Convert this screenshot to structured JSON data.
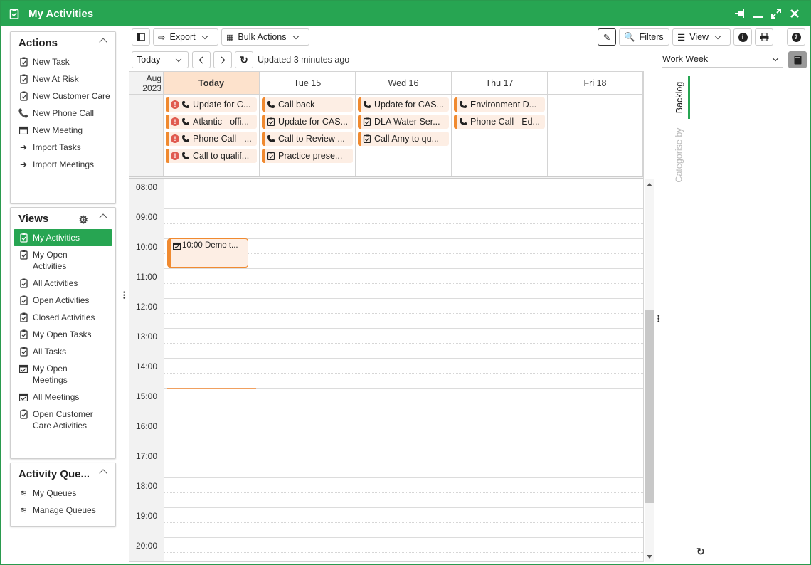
{
  "window": {
    "title": "My Activities"
  },
  "actions": {
    "title": "Actions",
    "items": [
      {
        "label": "New Task",
        "icon": "task-icon"
      },
      {
        "label": "New At Risk",
        "icon": "task-icon"
      },
      {
        "label": "New Customer Care",
        "icon": "task-icon"
      },
      {
        "label": "New Phone Call",
        "icon": "phone-icon"
      },
      {
        "label": "New Meeting",
        "icon": "calendar-icon"
      },
      {
        "label": "Import Tasks",
        "icon": "import-icon"
      },
      {
        "label": "Import Meetings",
        "icon": "import-icon"
      }
    ]
  },
  "views": {
    "title": "Views",
    "items": [
      {
        "label": "My Activities",
        "icon": "task-icon"
      },
      {
        "label": "My Open Activities",
        "icon": "task-icon"
      },
      {
        "label": "All Activities",
        "icon": "task-icon"
      },
      {
        "label": "Open Activities",
        "icon": "task-icon"
      },
      {
        "label": "Closed Activities",
        "icon": "task-icon"
      },
      {
        "label": "My Open Tasks",
        "icon": "task-icon"
      },
      {
        "label": "All Tasks",
        "icon": "task-icon"
      },
      {
        "label": "My Open Meetings",
        "icon": "calendar-check-icon"
      },
      {
        "label": "All Meetings",
        "icon": "calendar-check-icon"
      },
      {
        "label": "Open Customer Care Activities",
        "icon": "task-icon"
      }
    ]
  },
  "queues": {
    "title": "Activity Que...",
    "items": [
      {
        "label": "My Queues",
        "icon": "queue-icon"
      },
      {
        "label": "Manage Queues",
        "icon": "queue-icon"
      }
    ]
  },
  "toolbar": {
    "export": "Export",
    "bulk": "Bulk Actions",
    "filters": "Filters",
    "view": "View",
    "today": "Today",
    "updated": "Updated 3 minutes ago"
  },
  "calendar": {
    "month": "Aug",
    "year": "2023",
    "days": [
      "Today",
      "Tue 15",
      "Wed 16",
      "Thu 17",
      "Fri 18"
    ],
    "times": [
      "08:00",
      "09:00",
      "10:00",
      "11:00",
      "12:00",
      "13:00",
      "14:00",
      "15:00",
      "16:00",
      "17:00",
      "18:00",
      "19:00",
      "20:00"
    ],
    "allday": [
      [
        {
          "text": "Update for C...",
          "icon": "phone",
          "alert": true
        },
        {
          "text": "Atlantic - offi...",
          "icon": "phone",
          "alert": true
        },
        {
          "text": "Phone Call - ...",
          "icon": "phone",
          "alert": true
        },
        {
          "text": "Call to qualif...",
          "icon": "phone",
          "alert": true
        }
      ],
      [
        {
          "text": "Call back",
          "icon": "phone",
          "alert": false
        },
        {
          "text": "Update for CAS...",
          "icon": "task",
          "alert": false
        },
        {
          "text": "Call to Review ...",
          "icon": "phone",
          "alert": false
        },
        {
          "text": "Practice prese...",
          "icon": "task",
          "alert": false
        }
      ],
      [
        {
          "text": "Update for CAS...",
          "icon": "phone",
          "alert": false
        },
        {
          "text": "DLA Water Ser...",
          "icon": "task",
          "alert": false
        },
        {
          "text": "Call Amy to qu...",
          "icon": "task",
          "alert": false
        }
      ],
      [
        {
          "text": "Environment D...",
          "icon": "phone",
          "alert": false
        },
        {
          "text": "Phone Call - Ed...",
          "icon": "phone",
          "alert": false
        }
      ],
      []
    ],
    "meeting": {
      "text": "10:00 Demo t..."
    }
  },
  "side": {
    "select": "Work Week",
    "tab_backlog": "Backlog",
    "tab_categorise": "Categorise by"
  },
  "colors": {
    "accent": "#27a552",
    "event": "#f08a30",
    "eventbg": "#fdeee4"
  }
}
